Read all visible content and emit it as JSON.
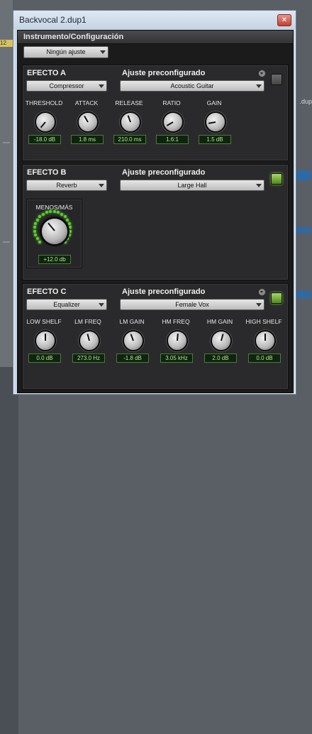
{
  "window": {
    "title": "Backvocal 2.dup1",
    "close_glyph": "×"
  },
  "background": {
    "left_track_label": "12",
    "right_track_label": ".dup"
  },
  "plugin": {
    "title": "Instrumento/Configuración",
    "preset_select": "Ningún ajuste"
  },
  "colors": {
    "bypass_active": "#7fc13a",
    "value_text": "#b5e68a",
    "panel_bg": "#2a2a2c"
  },
  "sections": {
    "a": {
      "label": "EFECTO A",
      "preset_label": "Ajuste preconfigurado",
      "type": "Compressor",
      "preset": "Acoustic Guitar",
      "bypass_on": false,
      "knobs": [
        {
          "label": "THRESHOLD",
          "value": "-18.0 dB"
        },
        {
          "label": "ATTACK",
          "value": "1.8 ms"
        },
        {
          "label": "RELEASE",
          "value": "210.0 ms"
        },
        {
          "label": "RATIO",
          "value": "1.6:1"
        },
        {
          "label": "GAIN",
          "value": "1.5 dB"
        }
      ]
    },
    "b": {
      "label": "EFECTO B",
      "preset_label": "Ajuste preconfigurado",
      "type": "Reverb",
      "preset": "Large Hall",
      "bypass_on": true,
      "knob": {
        "label": "MENOS/MÁS",
        "value": "+12.0 db"
      }
    },
    "c": {
      "label": "EFECTO C",
      "preset_label": "Ajuste preconfigurado",
      "type": "Equalizer",
      "preset": "Female Vox",
      "bypass_on": true,
      "knobs": [
        {
          "label": "LOW SHELF",
          "value": "0.0 dB"
        },
        {
          "label": "LM FREQ",
          "value": "273.0 Hz"
        },
        {
          "label": "LM GAIN",
          "value": "-1.8 dB"
        },
        {
          "label": "HM FREQ",
          "value": "3.05 kHz"
        },
        {
          "label": "HM GAIN",
          "value": "2.0 dB"
        },
        {
          "label": "HIGH SHELF",
          "value": "0.0 dB"
        }
      ]
    }
  }
}
